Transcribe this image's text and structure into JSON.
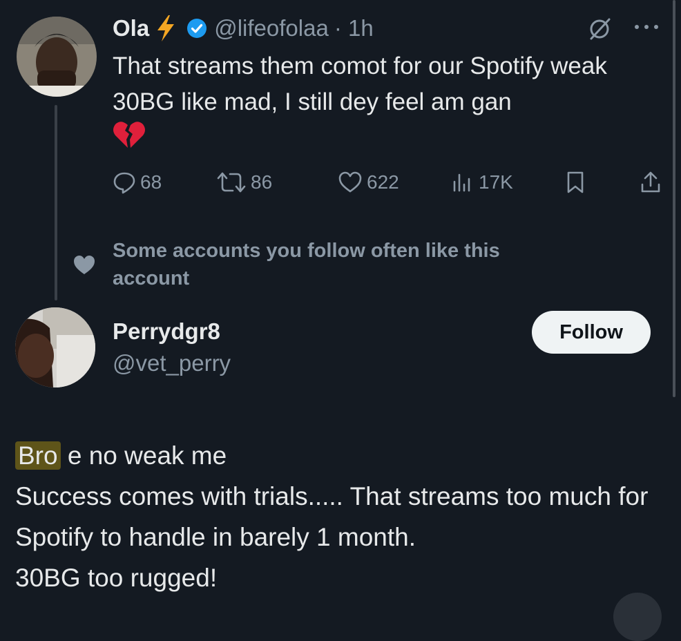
{
  "tweet": {
    "author": {
      "name": "Ola",
      "handle": "@lifeofolaa",
      "time": "· 1h",
      "verified": true,
      "name_emoji": "lightning-bolt"
    },
    "text": "That streams them comot for our Spotify weak 30BG like mad, I still dey feel am gan",
    "emoji": "broken-heart",
    "actions": {
      "replies": "68",
      "reposts": "86",
      "likes": "622",
      "views": "17K"
    }
  },
  "social_context": {
    "text": "Some accounts you follow often like this account"
  },
  "suggested_user": {
    "name": "Perrydgr8",
    "handle": "@vet_perry",
    "follow_label": "Follow"
  },
  "reply": {
    "highlight": "Bro",
    "line1_rest": " e no weak me",
    "line2": "Success comes with trials..... That streams too much for Spotify to handle in barely 1 month.",
    "line3": "30BG too rugged!"
  },
  "colors": {
    "background": "#141a22",
    "text": "#e7e9ea",
    "muted": "#8b98a5",
    "verified": "#1d9bf0",
    "bolt": "#f4a623",
    "highlight": "#5e5419",
    "follow_bg": "#eff3f4"
  }
}
